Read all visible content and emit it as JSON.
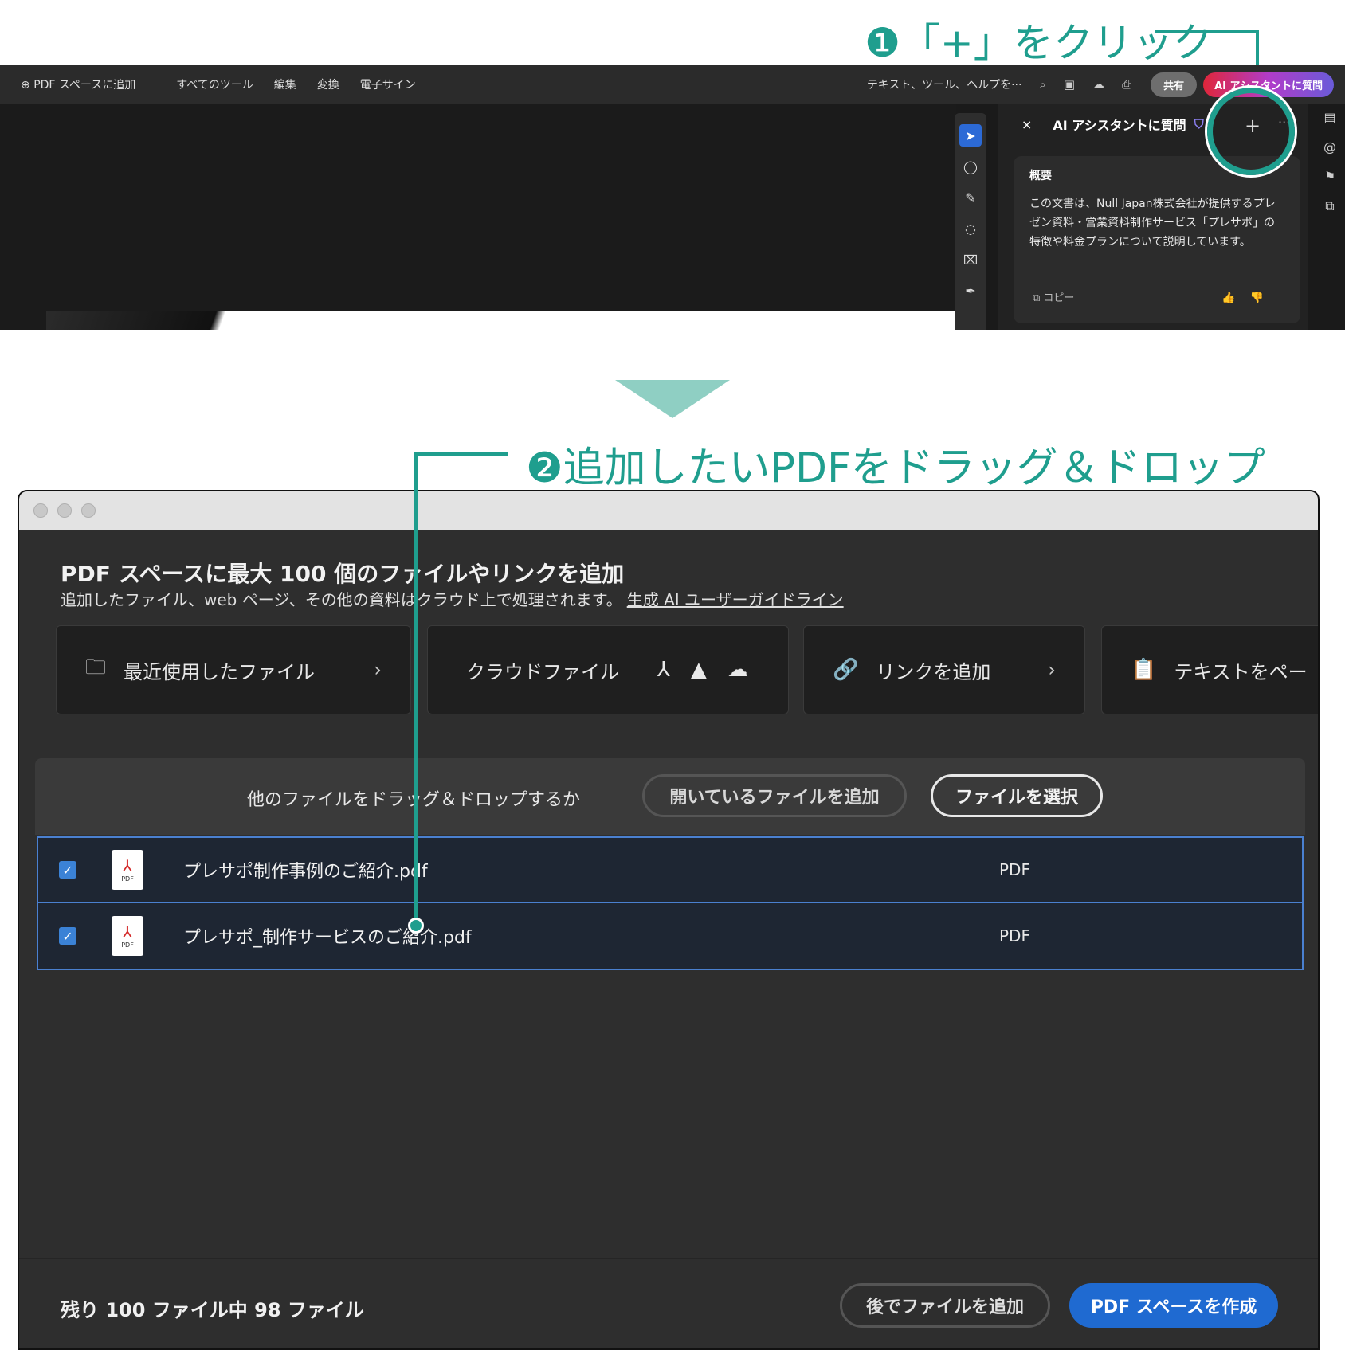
{
  "callouts": {
    "step1_num": "❶",
    "step1_text": "「+」をクリック",
    "step2_num": "❷",
    "step2_text": "追加したいPDFをドラッグ＆ドロップ"
  },
  "colors": {
    "accent": "#1f9e8e",
    "primary_button": "#1f6ad1",
    "checkbox": "#3b82d6"
  },
  "toolbar": {
    "add_pdf_space": "PDF スペースに追加",
    "all_tools": "すべてのツール",
    "edit": "編集",
    "convert": "変換",
    "esign": "電子サイン",
    "search_placeholder": "テキスト、ツール、ヘルプを···",
    "share": "共有",
    "ai_assistant": "AI アシスタントに質問"
  },
  "ai_panel": {
    "title": "AI アシスタントに質問",
    "close": "×",
    "plus": "+",
    "more": "···",
    "summary_heading": "概要",
    "summary_text": "この文書は、Null Japan株式会社が提供するプレゼン資料・営業資料制作サービス「プレサポ」の特徴や料金プランについて説明しています。",
    "copy": "コピー",
    "thumbs": "👍👎"
  },
  "dialog": {
    "title": "PDF スペースに最大 100 個のファイルやリンクを追加",
    "subtitle": "追加したファイル、web ページ、その他の資料はクラウド上で処理されます。",
    "guideline_link": "生成 AI ユーザーガイドライン",
    "sources": {
      "recent": "最近使用したファイル",
      "cloud": "クラウドファイル",
      "link": "リンクを追加",
      "paste_text": "テキストをペー"
    },
    "drop_text": "他のファイルをドラッグ＆ドロップするか",
    "add_open_files": "開いているファイルを追加",
    "select_files": "ファイルを選択",
    "files": [
      {
        "name": "プレサポ制作事例のご紹介.pdf",
        "type": "PDF"
      },
      {
        "name": "プレサポ_制作サービスのご紹介.pdf",
        "type": "PDF"
      }
    ],
    "pdf_icon_label": "PDF",
    "remaining": "残り 100 ファイル中 98 ファイル",
    "add_later": "後でファイルを追加",
    "create": "PDF スペースを作成"
  }
}
